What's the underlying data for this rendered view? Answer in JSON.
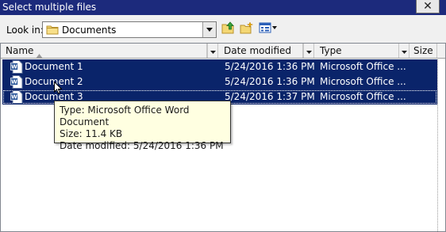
{
  "window": {
    "title": "Select multiple files"
  },
  "toolbar": {
    "look_in_label": "Look in:",
    "look_in_value": "Documents"
  },
  "columns": [
    {
      "label": "Name",
      "sort": "ascending"
    },
    {
      "label": "Date modified"
    },
    {
      "label": "Type"
    },
    {
      "label": "Size"
    }
  ],
  "files": [
    {
      "name": "Document 1",
      "date_modified": "5/24/2016 1:36 PM",
      "type": "Microsoft Office ...",
      "selected": true
    },
    {
      "name": "Document 2",
      "date_modified": "5/24/2016 1:36 PM",
      "type": "Microsoft Office ...",
      "selected": true
    },
    {
      "name": "Document 3",
      "date_modified": "5/24/2016 1:37 PM",
      "type": "Microsoft Office ...",
      "selected": true
    }
  ],
  "tooltip": {
    "type_line": "Type: Microsoft Office Word Document",
    "size_line": "Size: 11.4 KB",
    "date_line": "Date modified: 5/24/2016 1:36 PM"
  },
  "colors": {
    "title_bar": "#1c2a7c",
    "selection": "#0a246a",
    "tooltip_bg": "#ffffe1"
  }
}
